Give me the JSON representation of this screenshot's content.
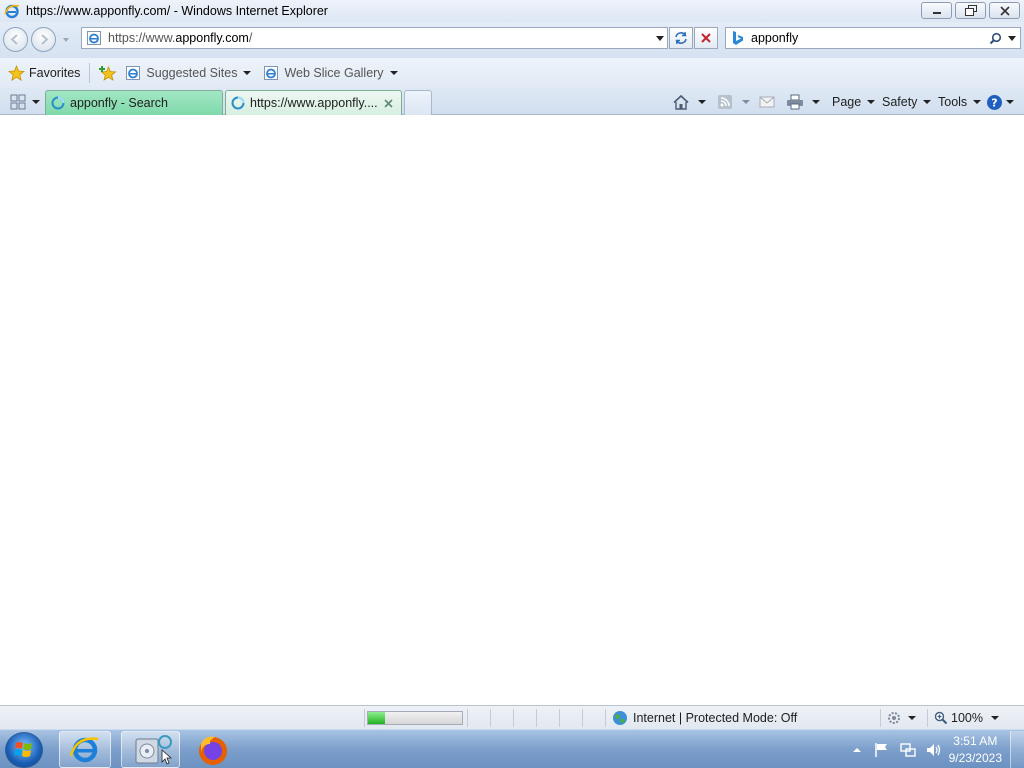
{
  "window": {
    "title": "https://www.apponfly.com/ - Windows Internet Explorer"
  },
  "address_bar": {
    "url_prefix": "https://www.",
    "url_domain": "apponfly.com",
    "url_suffix": "/"
  },
  "search": {
    "value": "apponfly"
  },
  "favorites_bar": {
    "favorites_label": "Favorites",
    "suggested_sites_label": "Suggested Sites",
    "web_slice_gallery_label": "Web Slice Gallery"
  },
  "tabs": [
    {
      "label": "apponfly - Search",
      "active": false
    },
    {
      "label": "https://www.apponfly....",
      "active": true
    }
  ],
  "command_bar": {
    "page_label": "Page",
    "safety_label": "Safety",
    "tools_label": "Tools"
  },
  "status_bar": {
    "zone_text": "Internet | Protected Mode: Off",
    "zoom_text": "100%",
    "progress_fraction": 0.18
  },
  "taskbar": {
    "time": "3:51 AM",
    "date": "9/23/2023"
  },
  "colors": {
    "active_tab": "#d7efe1",
    "inactive_tab": "#7fd9aa",
    "progress_fill": "#23b123",
    "taskbar": "#7c9fcb"
  }
}
